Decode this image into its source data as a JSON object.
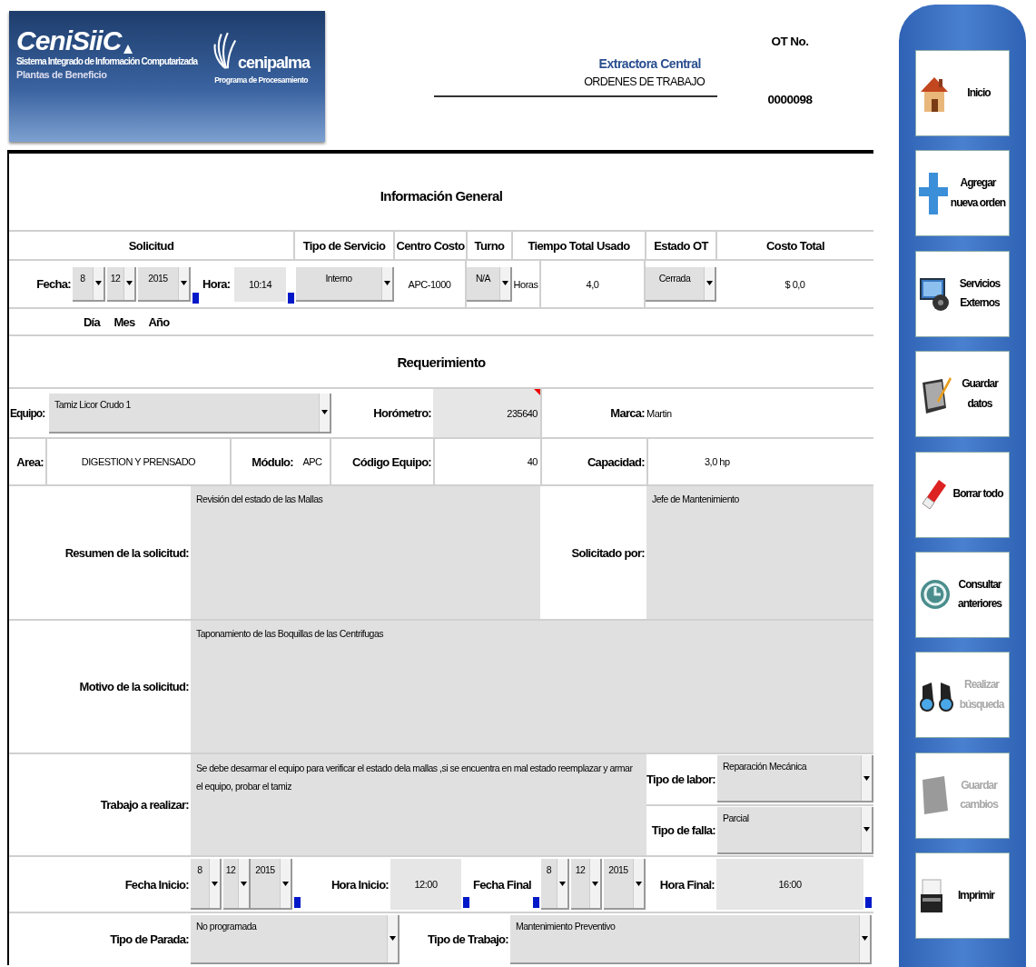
{
  "header": {
    "logo": {
      "title": "CeniSiiC",
      "subtitle": "Sistema Integrado de Información Computarizada",
      "tagline": "Plantas de Beneficio",
      "brand": "cenipalma",
      "brand_subtitle": "Programa de Procesamiento"
    },
    "company": "Extractora Central",
    "module": "ORDENES DE TRABAJO",
    "ot_label": "OT No.",
    "ot_number": "0000098"
  },
  "general": {
    "title": "Información General",
    "columns": [
      "Solicitud",
      "Tipo de Servicio",
      "Centro Costo",
      "Turno",
      "Tiempo Total Usado",
      "Estado OT",
      "Costo Total"
    ],
    "fecha_label": "Fecha:",
    "dia": "8",
    "mes": "12",
    "anio": "2015",
    "hora_label": "Hora:",
    "hora": "10:14",
    "tipo_servicio": "Interno",
    "centro_costo": "APC-1000",
    "turno": "N/A",
    "horas_label": "Horas",
    "tiempo": "4,0",
    "estado": "Cerrada",
    "costo": "$ 0,0",
    "date_parts": [
      "Día",
      "Mes",
      "Año"
    ]
  },
  "requerimiento": {
    "title": "Requerimiento",
    "equipo": {
      "label": "Equipo:",
      "value": "Tamiz Licor Crudo 1"
    },
    "horometro": {
      "label": "Horómetro:",
      "value": "235640",
      "flagged": true
    },
    "marca": {
      "label": "Marca:",
      "value": "Martin"
    },
    "area": {
      "label": "Area:",
      "value": "DIGESTION Y PRENSADO"
    },
    "modulo": {
      "label": "Módulo:",
      "value": "APC"
    },
    "codigo": {
      "label": "Código Equipo:",
      "value": "40"
    },
    "capacidad": {
      "label": "Capacidad:",
      "value": "3,0 hp"
    },
    "resumen": {
      "label": "Resumen de la solicitud:",
      "value": "Revisión del estado de las Mallas"
    },
    "solicitado": {
      "label": "Solicitado por:",
      "value": "Jefe de Mantenimiento"
    },
    "motivo": {
      "label": "Motivo de la solicitud:",
      "value": "Taponamiento de las Boquillas de las Centrifugas"
    },
    "trabajo": {
      "label": "Trabajo a realizar:",
      "value": "Se debe desarmar el equipo para verificar el estado dela mallas ,si se encuentra en mal estado reemplazar y armar el equipo, probar el tamiz"
    },
    "tipo_labor": {
      "label": "Tipo de labor:",
      "value": "Reparación Mecánica"
    },
    "tipo_falla": {
      "label": "Tipo de falla:",
      "value": "Parcial"
    },
    "fecha_inicio": {
      "label": "Fecha Inicio:",
      "dia": "8",
      "mes": "12",
      "anio": "2015"
    },
    "hora_inicio": {
      "label": "Hora Inicio:",
      "value": "12:00"
    },
    "fecha_final": {
      "label": "Fecha Final",
      "dia": "8",
      "mes": "12",
      "anio": "2015"
    },
    "hora_final": {
      "label": "Hora Final:",
      "value": "16:00"
    },
    "tipo_parada": {
      "label": "Tipo de Parada:",
      "value": "No programada"
    },
    "tipo_trabajo": {
      "label": "Tipo de Trabajo:",
      "value": "Mantenimiento Preventivo"
    }
  },
  "sidebar": [
    {
      "kind": "home",
      "label": "Inicio",
      "disabled": false
    },
    {
      "kind": "add",
      "label": "Agregar nueva orden",
      "disabled": false
    },
    {
      "kind": "services",
      "label": "Servicios Externos",
      "disabled": false
    },
    {
      "kind": "save",
      "label": "Guardar datos",
      "disabled": false
    },
    {
      "kind": "erase",
      "label": "Borrar todo",
      "disabled": false
    },
    {
      "kind": "history",
      "label": "Consultar anteriores",
      "disabled": false
    },
    {
      "kind": "search",
      "label": "Realizar búsqueda",
      "disabled": true
    },
    {
      "kind": "save_changes",
      "label": "Guardar cambios",
      "disabled": true
    },
    {
      "kind": "print",
      "label": "Imprimir",
      "disabled": false
    }
  ]
}
